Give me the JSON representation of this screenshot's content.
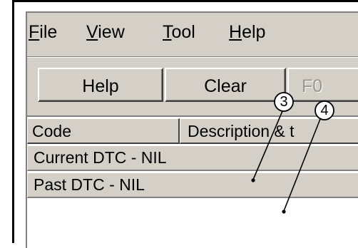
{
  "menubar": {
    "items": [
      {
        "label_mnemonic": "F",
        "label_rest": "ile"
      },
      {
        "label_mnemonic": "V",
        "label_rest": "iew"
      },
      {
        "label_mnemonic": "T",
        "label_rest": "ool"
      },
      {
        "label_mnemonic": "H",
        "label_rest": "elp"
      }
    ]
  },
  "toolbar": {
    "help_label": "Help",
    "clear_label": "Clear",
    "third_label": "F0"
  },
  "list": {
    "columns": [
      "Code",
      "Description & t"
    ],
    "rows": [
      "Current DTC - NIL",
      "Past DTC - NIL"
    ]
  },
  "callouts": [
    "3",
    "4"
  ]
}
